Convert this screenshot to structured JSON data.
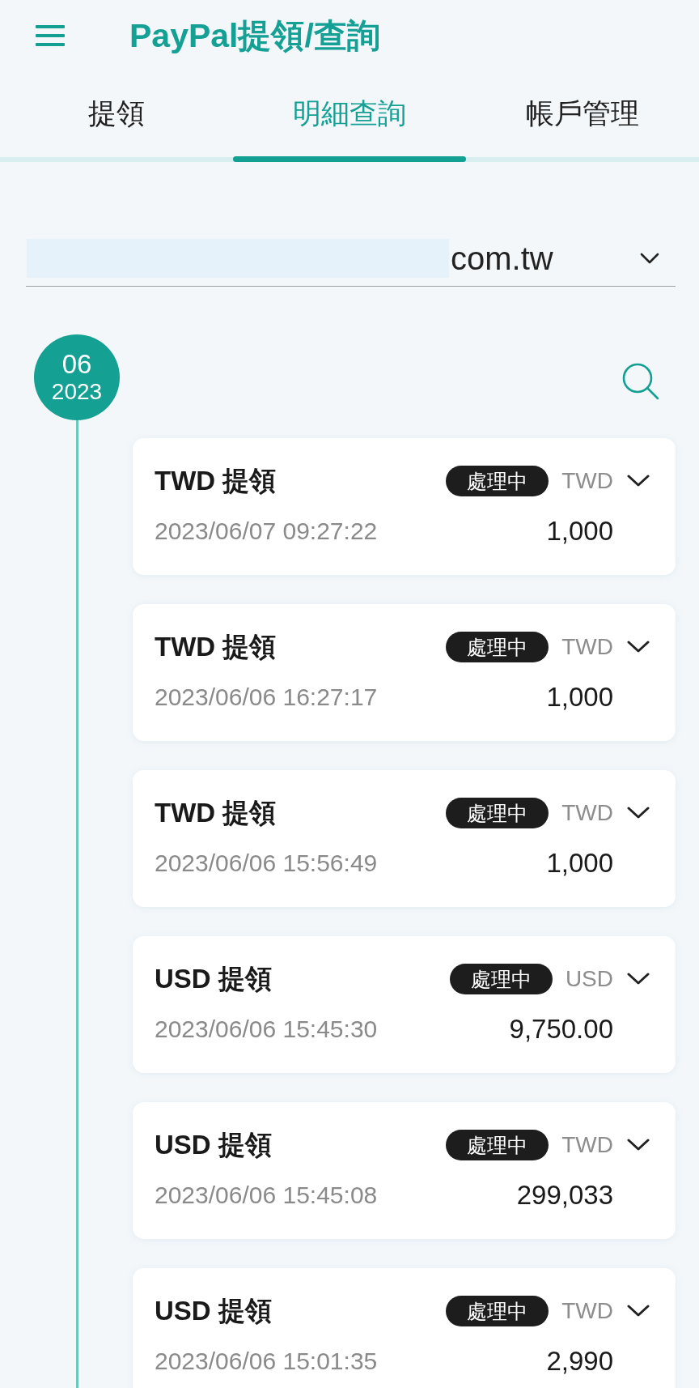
{
  "header": {
    "title": "PayPal提領/查詢"
  },
  "tabs": [
    {
      "label": "提領",
      "selected": false
    },
    {
      "label": "明細查詢",
      "selected": true
    },
    {
      "label": "帳戶管理",
      "selected": false
    }
  ],
  "account_select": {
    "redacted": true,
    "value": "com.tw"
  },
  "timeline": {
    "month": "06",
    "year": "2023",
    "transactions": [
      {
        "title": "TWD 提領",
        "status": "處理中",
        "currency": "TWD",
        "datetime": "2023/06/07 09:27:22",
        "amount": "1,000",
        "expanded": false
      },
      {
        "title": "TWD 提領",
        "status": "處理中",
        "currency": "TWD",
        "datetime": "2023/06/06 16:27:17",
        "amount": "1,000",
        "expanded": false
      },
      {
        "title": "TWD 提領",
        "status": "處理中",
        "currency": "TWD",
        "datetime": "2023/06/06 15:56:49",
        "amount": "1,000",
        "expanded": false
      },
      {
        "title": "USD 提領",
        "status": "處理中",
        "currency": "USD",
        "datetime": "2023/06/06 15:45:30",
        "amount": "9,750.00",
        "expanded": false
      },
      {
        "title": "USD 提領",
        "status": "處理中",
        "currency": "TWD",
        "datetime": "2023/06/06 15:45:08",
        "amount": "299,033",
        "expanded": false
      },
      {
        "title": "USD 提領",
        "status": "處理中",
        "currency": "TWD",
        "datetime": "2023/06/06 15:01:35",
        "amount": "2,990",
        "expanded": false
      }
    ]
  }
}
